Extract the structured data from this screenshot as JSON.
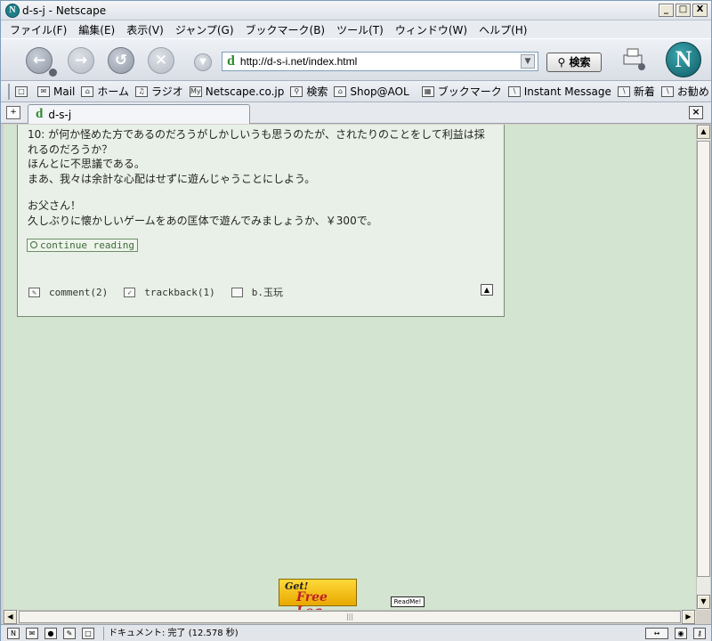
{
  "window": {
    "title": "d-s-j - Netscape",
    "minimize": "_",
    "maximize": "□",
    "close": "X",
    "app_icon": "N"
  },
  "menu": [
    "ファイル(F)",
    "編集(E)",
    "表示(V)",
    "ジャンプ(G)",
    "ブックマーク(B)",
    "ツール(T)",
    "ウィンドウ(W)",
    "ヘルプ(H)"
  ],
  "nav": {
    "url": "http://d-s-i.net/index.html",
    "search_label": "検索",
    "brand_letter": "N"
  },
  "personal_toolbar": [
    {
      "icon": "mail-icon",
      "label": "Mail"
    },
    {
      "icon": "home-icon",
      "label": "ホーム"
    },
    {
      "icon": "radio-icon",
      "label": "ラジオ"
    },
    {
      "icon": "my-icon",
      "label": "Netscape.co.jp"
    },
    {
      "icon": "search-icon",
      "label": "検索"
    },
    {
      "icon": "shop-icon",
      "label": "Shop@AOL"
    },
    {
      "icon": "folder-icon",
      "label": "ブックマーク"
    },
    {
      "icon": "bookmark-icon",
      "label": "Instant Message"
    },
    {
      "icon": "bookmark-icon",
      "label": "新着"
    },
    {
      "icon": "bookmark-icon",
      "label": "お勧め"
    }
  ],
  "tab": {
    "label": "d-s-j"
  },
  "post": {
    "lines_top": [
      "10: が何か怪めた方であるのだろうがしかしいうも思うのたが、されたりのことをして利益は採",
      "れるのだろうか？",
      "ほんとに不思議である。",
      "まあ、我々は余計な心配はせずに遊んじゃうことにしよう。"
    ],
    "lines_bottom": [
      "お父さん！",
      "久しぶりに懐かしいゲームをあの匡体で遊んでみましょうか、￥300で。"
    ],
    "continue_label": "continue reading",
    "comment_label": "comment(2)",
    "trackback_label": "trackback(1)",
    "category_label": "b.玉玩"
  },
  "footer": {
    "badge_line1": "Get!",
    "badge_line2": "Free Log",
    "readme_label": "ReadMe!"
  },
  "status": {
    "text": "ドキュメント: 完了 (12.578 秒)"
  }
}
